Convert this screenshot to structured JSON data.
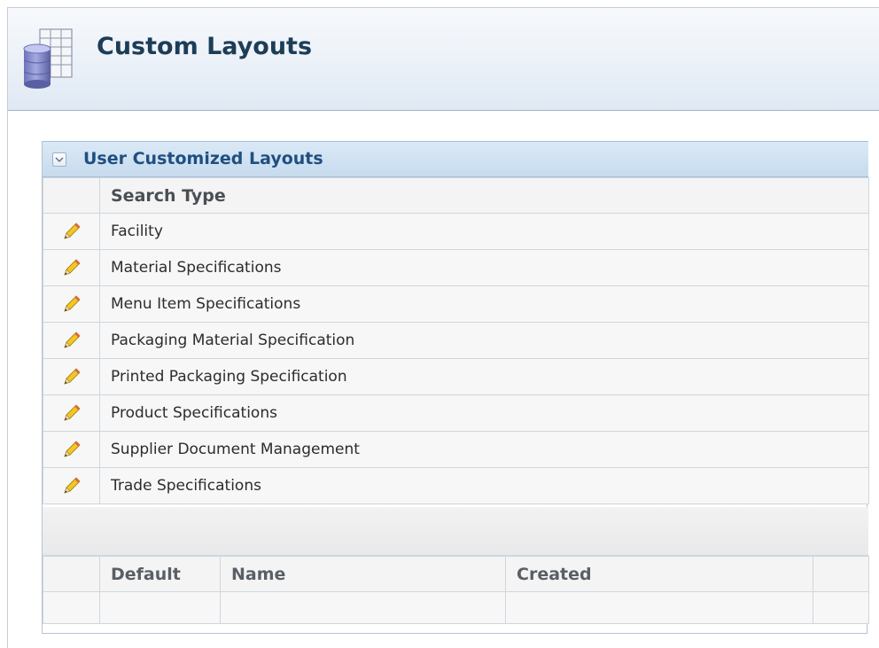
{
  "page": {
    "title": "Custom Layouts",
    "icon": "database-grid-icon"
  },
  "panel": {
    "title": "User Customized Layouts",
    "collapse_icon": "chevron-down-icon"
  },
  "search_types": {
    "column_header": "Search Type",
    "edit_icon": "pencil-icon",
    "rows": [
      {
        "name": "Facility"
      },
      {
        "name": "Material Specifications"
      },
      {
        "name": "Menu Item Specifications"
      },
      {
        "name": "Packaging Material Specification"
      },
      {
        "name": "Printed Packaging Specification"
      },
      {
        "name": "Product Specifications"
      },
      {
        "name": "Supplier Document Management"
      },
      {
        "name": "Trade Specifications"
      }
    ]
  },
  "layouts": {
    "columns": [
      "Default",
      "Name",
      "Created"
    ]
  },
  "colors": {
    "title": "#1d3d57",
    "panel_title": "#1f4f80",
    "panel_header_bg": "#c7dbee",
    "border": "#cfd6de"
  }
}
